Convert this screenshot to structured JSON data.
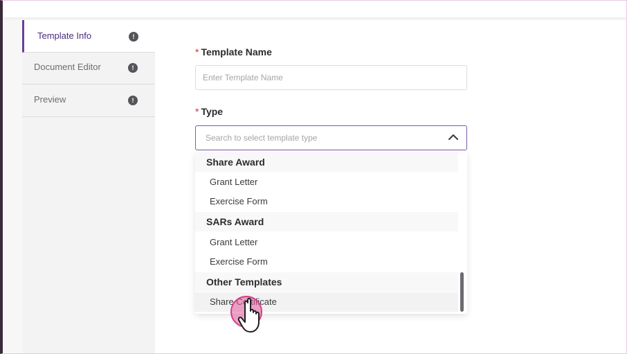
{
  "sidebar": {
    "steps": [
      {
        "label": "Template Info",
        "badge": "!"
      },
      {
        "label": "Document Editor",
        "badge": "!"
      },
      {
        "label": "Preview",
        "badge": "!"
      }
    ],
    "active_step": 0
  },
  "form": {
    "template_name": {
      "required_mark": "*",
      "label": "Template Name",
      "placeholder": "Enter Template Name",
      "value": ""
    },
    "type": {
      "required_mark": "*",
      "label": "Type",
      "placeholder": "Search to select template type",
      "open": true
    }
  },
  "dropdown": {
    "groups": [
      {
        "heading": "Share Award",
        "options": [
          "Grant Letter",
          "Exercise Form"
        ]
      },
      {
        "heading": "SARs Award",
        "options": [
          "Grant Letter",
          "Exercise Form"
        ]
      },
      {
        "heading": "Other Templates",
        "options": [
          "Share Certificate"
        ]
      }
    ],
    "hovered_option": "Share Certificate"
  },
  "colors": {
    "accent": "#6a3d9a",
    "required": "#d0312d",
    "cursor_highlight": "#e35a9a"
  },
  "icons": {
    "info_badge": "exclamation-circle-icon",
    "select_toggle": "chevron-up-icon",
    "pointer": "hand-pointer-icon"
  }
}
